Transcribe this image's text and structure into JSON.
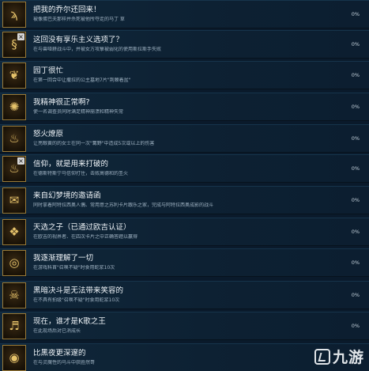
{
  "achievements": [
    {
      "title": "把我的乔尔还回来！",
      "desc": "被像蛋巴夫那样并杀死被他所夺走的马丁 草",
      "percent": "0%",
      "icon": "feather-icon",
      "glyph": "ϡ",
      "locked": false
    },
    {
      "title": "这回没有享乐主义选项了？",
      "desc": "在与兽哑耕战斗中，并被女方攻撃被弱化的使用斯拉斯手失败",
      "percent": "0%",
      "icon": "serpent-icon",
      "glyph": "§",
      "locked": true
    },
    {
      "title": "园丁很忙",
      "desc": "在第一回合中让撒拉的公主墓地7片\"荆棘着盆\"",
      "percent": "0%",
      "icon": "plant-icon",
      "glyph": "❦",
      "locked": false
    },
    {
      "title": "我精神很正常啊?",
      "desc": "使一名调查员同时满足精神崩溃和精神失常",
      "percent": "0%",
      "icon": "brain-icon",
      "glyph": "✺",
      "locked": false
    },
    {
      "title": "怒火燎原",
      "desc": "让亮眼黄的的女士在同一次\"篝野\"中造成5次或以上的伤害",
      "percent": "0%",
      "icon": "flame-icon",
      "glyph": "♨",
      "locked": false
    },
    {
      "title": "信仰，就是用来打破的",
      "desc": "在德斯特斯宁马信仰打住，击败高德和的圣火",
      "percent": "0%",
      "icon": "broken-flame-icon",
      "glyph": "♨",
      "locked": true
    },
    {
      "title": "来自幻梦境的邀请函",
      "desc": "同时拿着阿特拉西奥人偶、常用意之苏利卡片跟乐之家，完成与阿特拉西奥成影的战斗",
      "percent": "0%",
      "icon": "invitation-icon",
      "glyph": "✉",
      "locked": false
    },
    {
      "title": "天选之子（已通过欧吉认证）",
      "desc": "在欧吉的视界者、在四次卡片之中正确答题以赢得",
      "percent": "0%",
      "icon": "cat-icon",
      "glyph": "❖",
      "locked": false
    },
    {
      "title": "我逐渐理解了一切",
      "desc": "在游戏科首\"召唤不疑\"时食用蛇浆10次",
      "percent": "0%",
      "icon": "eye-ring-icon",
      "glyph": "◎",
      "locked": false
    },
    {
      "title": "黑暗决斗是无法带来笑容的",
      "desc": "在不具有拍级\"召唤不疑\"时食用蛇浆10次",
      "percent": "0%",
      "icon": "skull-icon",
      "glyph": "☠",
      "locked": false
    },
    {
      "title": "现在，谁才是K歌之王",
      "desc": "在此现场后对已消成长",
      "percent": "0%",
      "icon": "microphone-icon",
      "glyph": "♬",
      "locked": false
    },
    {
      "title": "比黑夜更深邃的",
      "desc": "在与灵魔性的乌斗中获胜然哥",
      "percent": "0%",
      "icon": "eye-icon",
      "glyph": "◉",
      "locked": false
    }
  ],
  "watermark": {
    "text": "九游"
  }
}
